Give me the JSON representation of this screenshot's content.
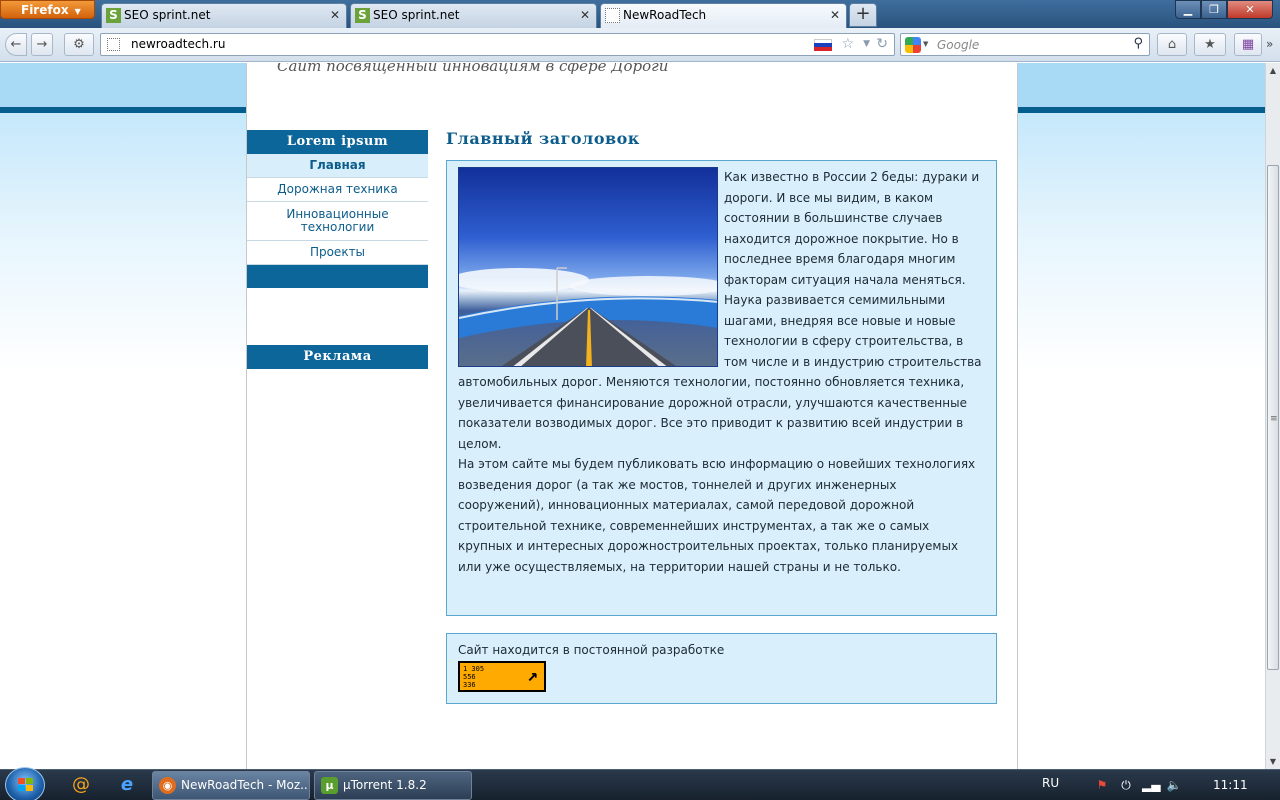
{
  "browser": {
    "menu_button": "Firefox",
    "tabs": [
      {
        "label": "SEO sprint.net",
        "favicon": "S"
      },
      {
        "label": "SEO sprint.net",
        "favicon": "S"
      },
      {
        "label": "NewRoadTech",
        "favicon": ""
      }
    ],
    "new_tab": "+",
    "url": "newroadtech.ru",
    "search_placeholder": "Google"
  },
  "page": {
    "tagline": "Сайт посвященный инновациям в сфере  Дороги",
    "sidebar": {
      "menu_title": "Lorem ipsum",
      "items": [
        {
          "label": "Главная",
          "active": true
        },
        {
          "label": "Дорожная техника",
          "active": false
        },
        {
          "label": "Инновационные технологии",
          "active": false
        },
        {
          "label": "Проекты",
          "active": false
        }
      ],
      "ads_title": "Реклама"
    },
    "main": {
      "heading": "Главный заголовок",
      "paragraph_1": "Как известно в России 2 беды: дураки и дороги. И все мы видим, в каком состоянии в большинстве случаев находится дорожное покрытие. Но в последнее время благодаря многим факторам ситуация начала меняться. Наука развивается семимильными шагами, внедряя все новые и новые технологии в сферу строительства, в том числе и в индустрию строительства автомобильных дорог. Меняются технологии, постоянно обновляется техника, увеличивается финансирование дорожной отрасли, улучшаются качественные показатели возводимых дорог. Все это приводит к развитию всей индустрии в целом.",
      "paragraph_2": "На этом сайте мы будем публиковать всю информацию о новейших технологиях возведения дорог (а так же мостов, тоннелей и других инженерных сооружений), инновационных материалах, самой передовой дорожной строительной технике, современнейших инструментах, а так же о самых крупных и интересных дорожностроительных проектах, только планируемых или уже осуществляемых, на территории нашей страны и не только.",
      "note": "Сайт находится в постоянной разработке",
      "counter": [
        "1 305",
        "556",
        "336"
      ]
    }
  },
  "taskbar": {
    "tasks": [
      {
        "label": "NewRoadTech - Moz..."
      },
      {
        "label": "µTorrent 1.8.2"
      }
    ],
    "lang": "RU",
    "clock": "11:11"
  },
  "colors": {
    "accent": "#0d6699",
    "light_blue": "#d9effc",
    "band": "#a8daf6",
    "counter_bg": "#ffaa00"
  }
}
